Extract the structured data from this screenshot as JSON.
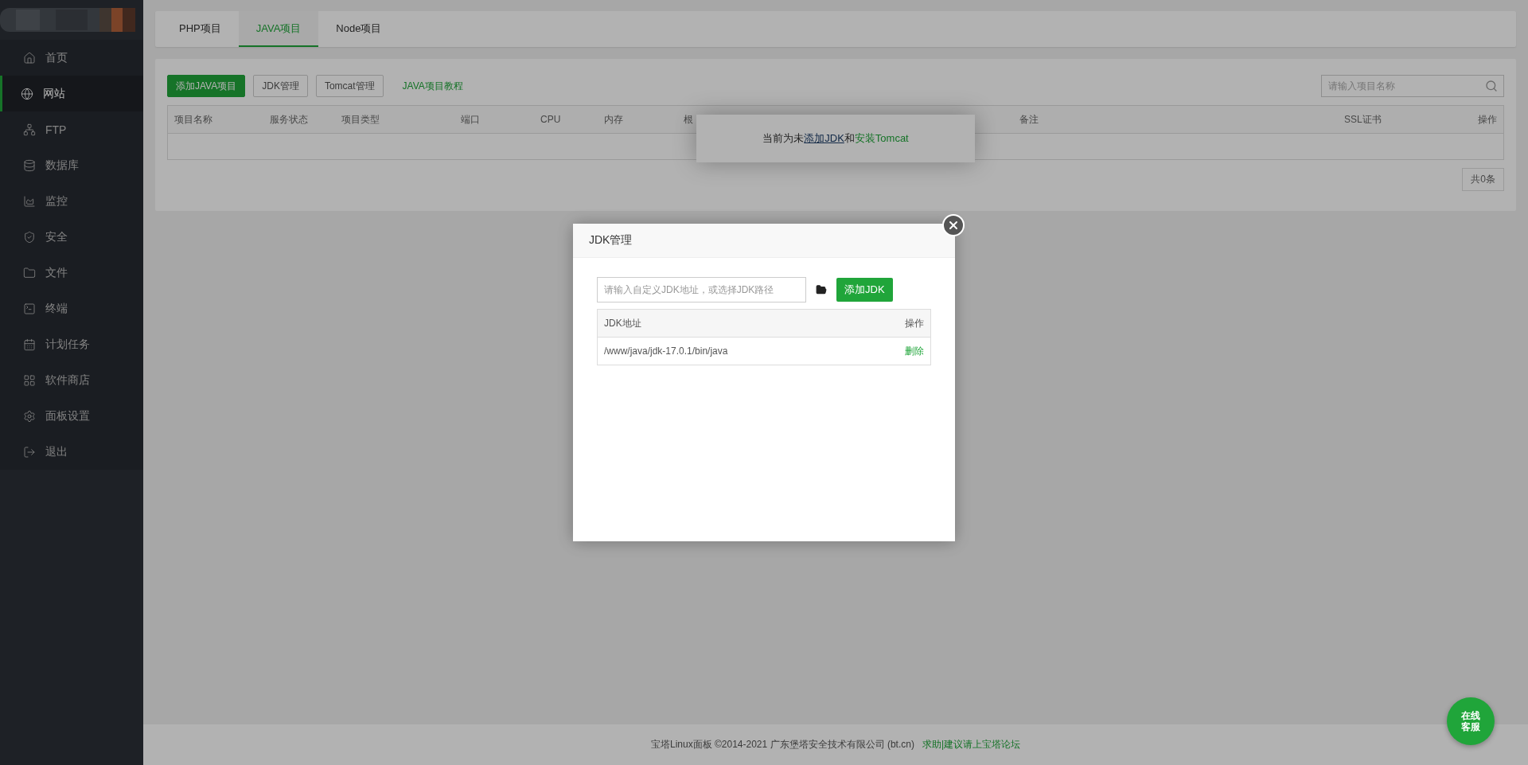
{
  "sidebar": {
    "items": [
      {
        "label": "首页",
        "selected": false
      },
      {
        "label": "网站",
        "selected": true
      },
      {
        "label": "FTP",
        "selected": false
      },
      {
        "label": "数据库",
        "selected": false
      },
      {
        "label": "监控",
        "selected": false
      },
      {
        "label": "安全",
        "selected": false
      },
      {
        "label": "文件",
        "selected": false
      },
      {
        "label": "终端",
        "selected": false
      },
      {
        "label": "计划任务",
        "selected": false
      },
      {
        "label": "软件商店",
        "selected": false
      },
      {
        "label": "面板设置",
        "selected": false
      },
      {
        "label": "退出",
        "selected": false
      }
    ]
  },
  "tabs": [
    {
      "label": "PHP项目",
      "selected": false
    },
    {
      "label": "JAVA项目",
      "selected": true
    },
    {
      "label": "Node项目",
      "selected": false
    }
  ],
  "toolbar": {
    "buttons": [
      {
        "label": "添加JAVA项目",
        "kind": "primary"
      },
      {
        "label": "JDK管理",
        "kind": "plain"
      },
      {
        "label": "Tomcat管理",
        "kind": "plain"
      },
      {
        "label": "JAVA项目教程",
        "kind": "link"
      }
    ],
    "search": {
      "placeholder": "请输入项目名称"
    }
  },
  "table": {
    "columns": [
      "项目名称",
      "服务状态",
      "项目类型",
      "端口",
      "CPU",
      "内存",
      "根",
      "备注",
      "SSL证书",
      "操作"
    ],
    "pager": "共0条"
  },
  "toast": {
    "parts": [
      {
        "text": "当前为未",
        "kind": "plain"
      },
      {
        "text": "添加JDK",
        "kind": "link"
      },
      {
        "text": "和",
        "kind": "plain"
      },
      {
        "text": "安装Tomcat",
        "kind": "action"
      }
    ]
  },
  "dialog": {
    "title": "JDK管理",
    "input": {
      "placeholder": "请输入自定义JDK地址，或选择JDK路径"
    },
    "add_button": "添加JDK",
    "table": {
      "columns": [
        "JDK地址",
        "操作"
      ],
      "rows": [
        {
          "path": "/www/java/jdk-17.0.1/bin/java",
          "action": "删除"
        }
      ]
    }
  },
  "footer": {
    "copyright": "宝塔Linux面板 ©2014-2021 广东堡塔安全技术有限公司 (bt.cn)",
    "link": "求助|建议请上宝塔论坛"
  },
  "service_button": {
    "lines": [
      "在线",
      "客服"
    ]
  }
}
